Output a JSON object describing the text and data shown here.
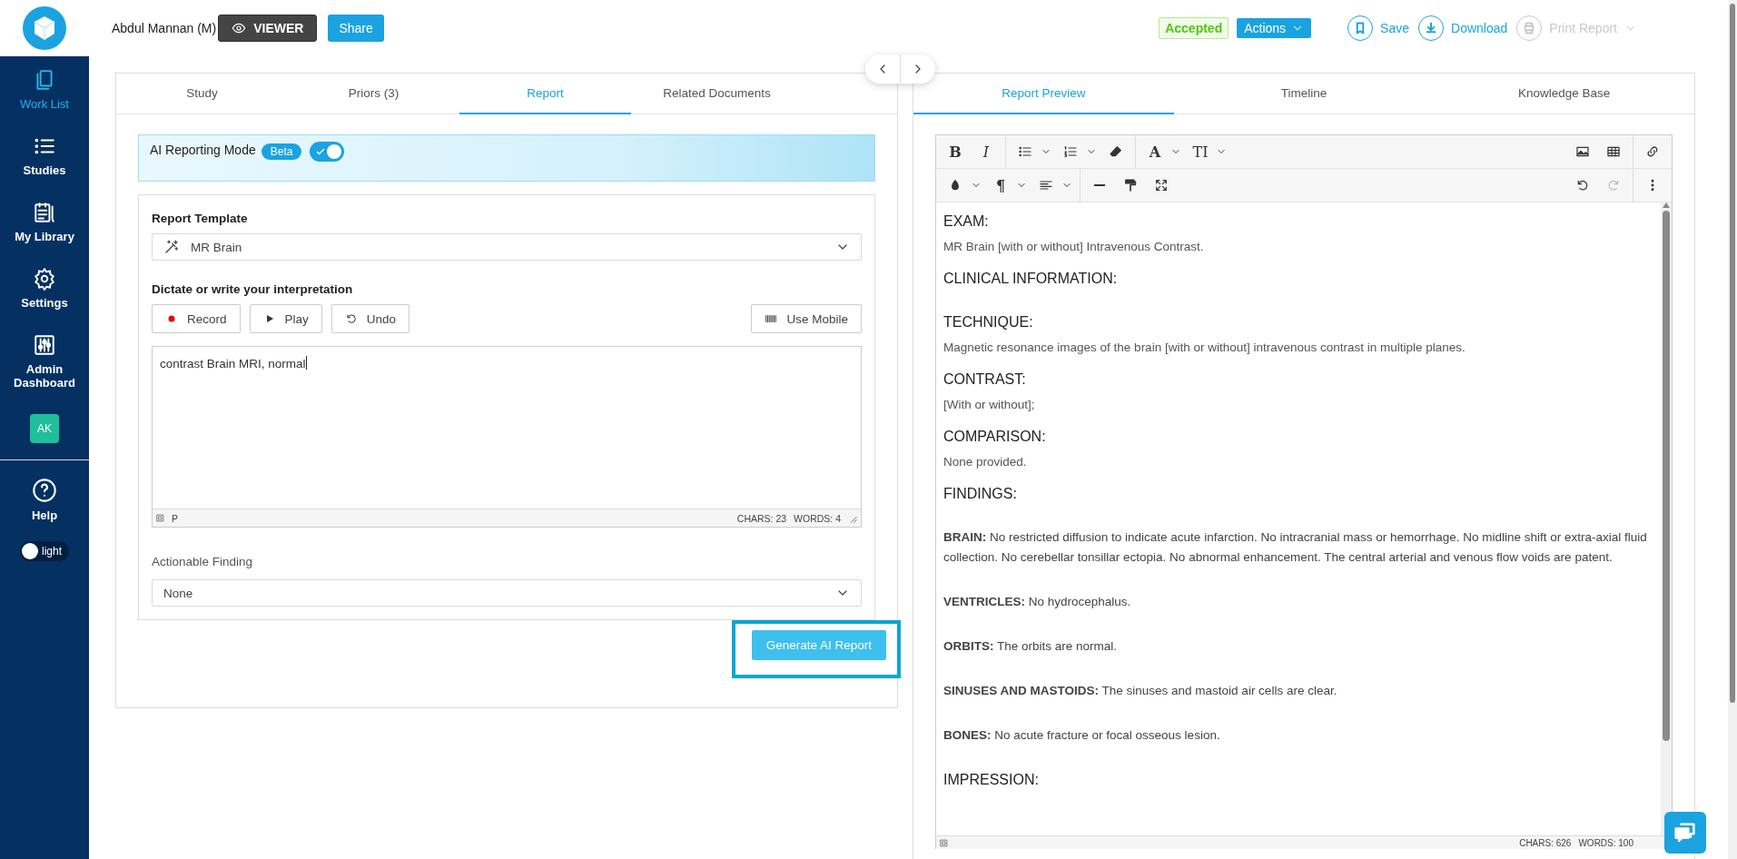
{
  "sidebar": {
    "items": [
      {
        "label": "Work List",
        "selected": true
      },
      {
        "label": "Studies",
        "selected": false
      },
      {
        "label": "My Library",
        "selected": false
      },
      {
        "label": "Settings",
        "selected": false
      },
      {
        "label": "Admin Dashboard",
        "selected": false
      }
    ],
    "avatar": "AK",
    "help": "Help",
    "theme": {
      "label": "light",
      "on": false
    }
  },
  "header": {
    "patient": "Abdul Mannan (M)",
    "mode": "VIEWER",
    "share": "Share",
    "status": "Accepted",
    "actions": "Actions",
    "tools": [
      {
        "label": "Save",
        "disabled": false
      },
      {
        "label": "Download",
        "disabled": false
      },
      {
        "label": "Print Report",
        "disabled": true
      }
    ]
  },
  "left_panel": {
    "tabs": [
      {
        "label": "Study",
        "selected": false
      },
      {
        "label": "Priors (3)",
        "selected": false
      },
      {
        "label": "Report",
        "selected": true
      },
      {
        "label": "Related Documents",
        "selected": false
      }
    ],
    "ai_mode": {
      "label": "AI Reporting Mode",
      "badge": "Beta",
      "on": true
    },
    "template": {
      "label": "Report Template",
      "value": "MR Brain"
    },
    "dictation": {
      "label": "Dictate or write your interpretation",
      "buttons": [
        {
          "label": "Record",
          "kind": "record"
        },
        {
          "label": "Play",
          "kind": "play"
        },
        {
          "label": "Undo",
          "kind": "undo"
        }
      ],
      "mobile": "Use Mobile",
      "text": "contrast Brain MRI, normal",
      "path": "P",
      "chars": "CHARS: 23",
      "words": "WORDS: 4"
    },
    "actionable": {
      "label": "Actionable Finding",
      "value": "None"
    },
    "generate": {
      "label": "Generate AI Report",
      "highlighted": true
    }
  },
  "right_panel": {
    "tabs": [
      {
        "label": "Report Preview",
        "selected": true
      },
      {
        "label": "Timeline",
        "selected": false
      },
      {
        "label": "Knowledge Base",
        "selected": false
      }
    ],
    "toolbar": {
      "bold": "B",
      "italic": "I",
      "font_color": "A",
      "font_size": "TI",
      "paragraph": "¶",
      "redo": {
        "disabled": true
      }
    },
    "report": [
      {
        "kind": "heading",
        "text": "EXAM:"
      },
      {
        "kind": "text",
        "text": "MR Brain [with or without] Intravenous Contrast."
      },
      {
        "kind": "heading",
        "text": "CLINICAL INFORMATION:"
      },
      {
        "kind": "heading",
        "text": "TECHNIQUE:"
      },
      {
        "kind": "text",
        "text": "Magnetic resonance images of the brain [with or without] intravenous contrast in multiple planes."
      },
      {
        "kind": "heading",
        "text": "CONTRAST:"
      },
      {
        "kind": "text",
        "text": "[With or without];"
      },
      {
        "kind": "heading",
        "text": "COMPARISON:"
      },
      {
        "kind": "text",
        "text": "None provided."
      },
      {
        "kind": "heading",
        "text": "FINDINGS:"
      },
      {
        "kind": "finding",
        "text": "**BRAIN:** No restricted diffusion to indicate acute infarction. No intracranial mass or hemorrhage. No midline shift or extra-axial fluid collection. No cerebellar tonsillar ectopia. No abnormal enhancement. The central arterial and venous flow voids are patent."
      },
      {
        "kind": "finding",
        "text": "**VENTRICLES:** No hydrocephalus."
      },
      {
        "kind": "finding",
        "text": "**ORBITS:** The orbits are normal."
      },
      {
        "kind": "finding",
        "text": "**SINUSES AND MASTOIDS:** The sinuses and mastoid air cells are clear."
      },
      {
        "kind": "finding",
        "text": "**BONES:** No acute fracture or focal osseous lesion."
      },
      {
        "kind": "heading",
        "text": "IMPRESSION:"
      }
    ],
    "chars": "CHARS: 626",
    "words": "WORDS: 100"
  }
}
